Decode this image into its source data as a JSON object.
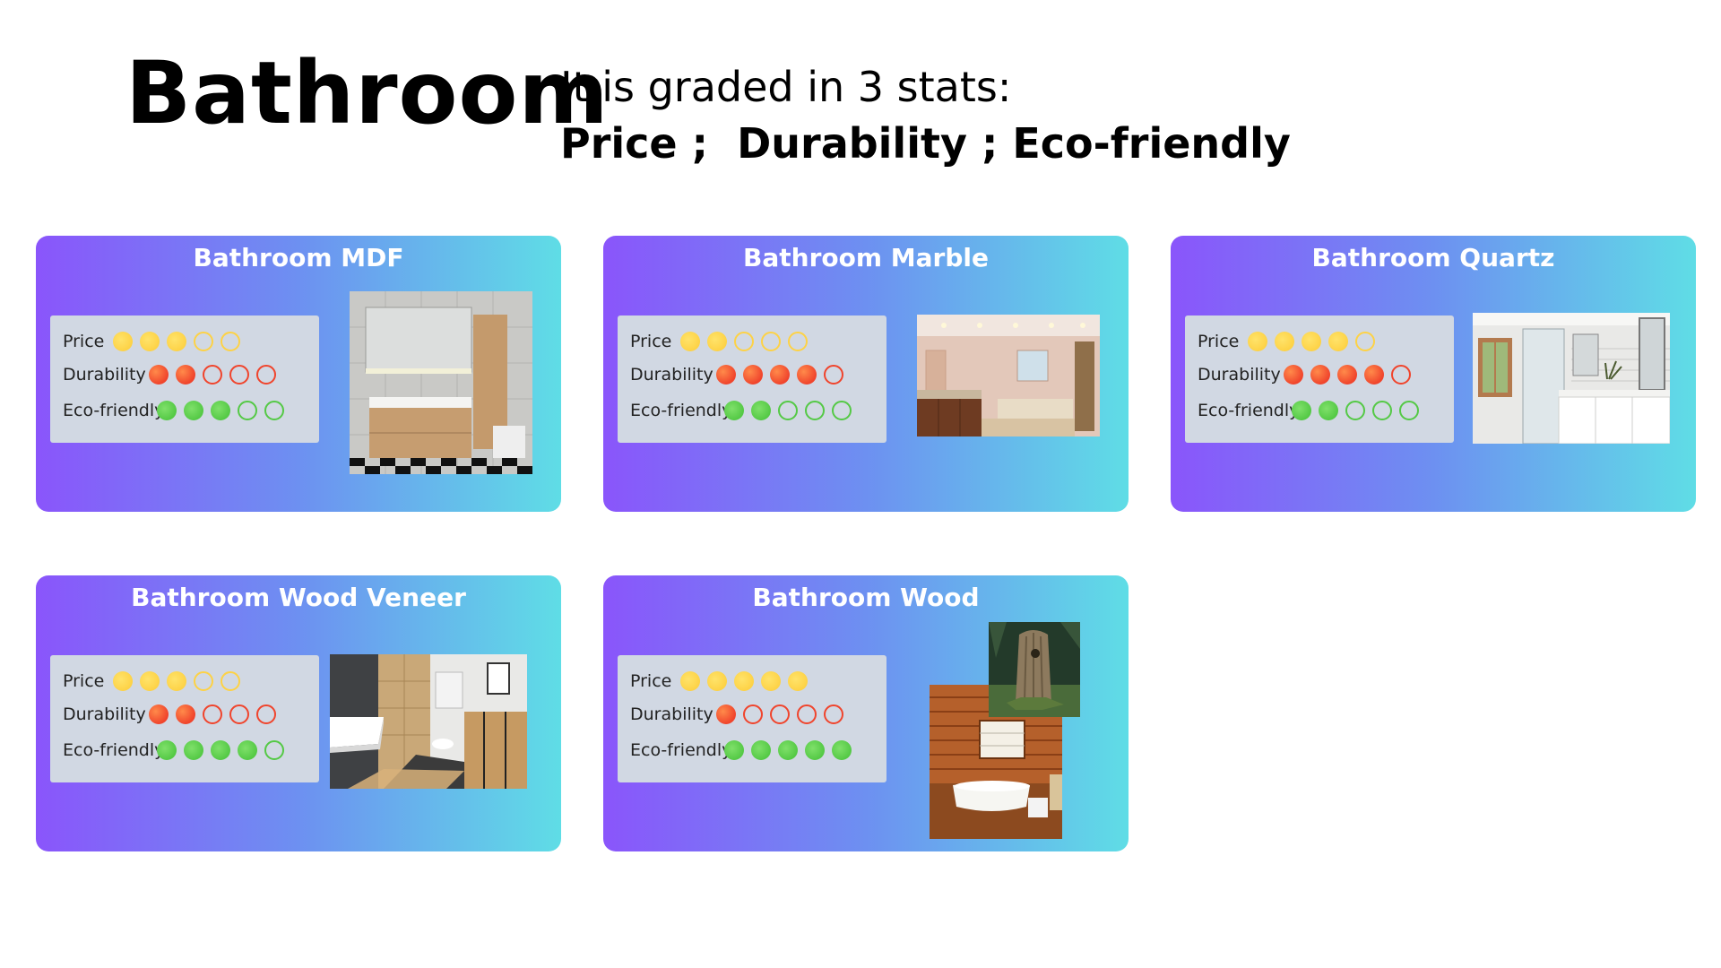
{
  "header": {
    "title": "Bathroom",
    "subtitle_line1": "It is graded in 3 stats:",
    "subtitle_line2": "Price ;  Durability ; Eco-friendly"
  },
  "stat_labels": {
    "price": "Price",
    "durability": "Durability",
    "eco": "Eco-friendly"
  },
  "colors": {
    "price": "#fdd246",
    "durability": "#f0442c",
    "eco": "#54c945",
    "card_start": "#8a55fb",
    "card_end": "#5fdde6",
    "stats_box": "#d1d8e3"
  },
  "max_rating": 5,
  "cards": [
    {
      "title": "Bathroom MDF",
      "price": 3,
      "durability": 2,
      "eco": 3,
      "image_icon": "mdf-vanity-photo"
    },
    {
      "title": "Bathroom Marble",
      "price": 2,
      "durability": 4,
      "eco": 2,
      "image_icon": "marble-bathroom-photo"
    },
    {
      "title": "Bathroom Quartz",
      "price": 4,
      "durability": 4,
      "eco": 2,
      "image_icon": "quartz-bathroom-photo"
    },
    {
      "title": "Bathroom Wood Veneer",
      "price": 3,
      "durability": 2,
      "eco": 4,
      "image_icon": "wood-veneer-bathroom-photo"
    },
    {
      "title": "Bathroom Wood",
      "price": 5,
      "durability": 1,
      "eco": 5,
      "image_icon": "wooden-cabin-bathroom-photo"
    }
  ]
}
